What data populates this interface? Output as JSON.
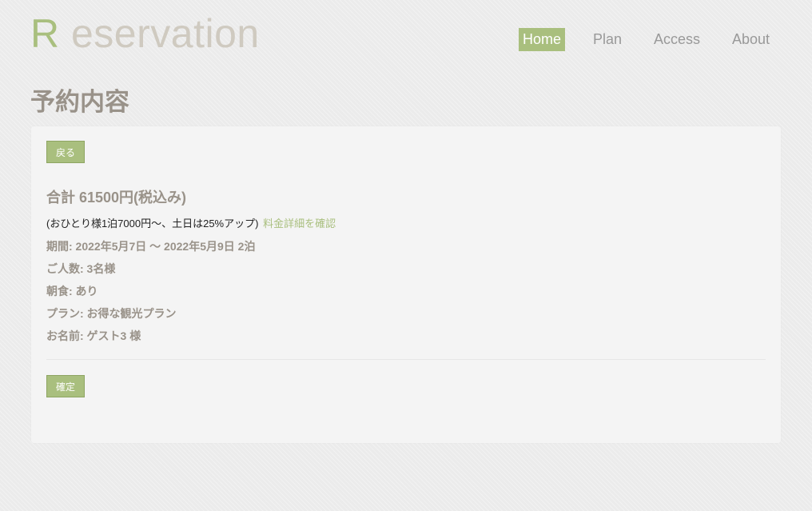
{
  "logo": {
    "initial": "R",
    "rest": " eservation"
  },
  "nav": {
    "items": [
      {
        "label": "Home",
        "active": true
      },
      {
        "label": "Plan",
        "active": false
      },
      {
        "label": "Access",
        "active": false
      },
      {
        "label": "About",
        "active": false
      }
    ]
  },
  "page_title": "予約内容",
  "back_button": "戻る",
  "total": "合計 61500円(税込み)",
  "total_note": {
    "text": "(おひとり様1泊7000円～、土日は25%アップ)",
    "link": "料金詳細を確認"
  },
  "details": {
    "period": "期間: 2022年5月7日 〜 2022年5月9日 2泊",
    "people": "ご人数: 3名様",
    "breakfast": "朝食: あり",
    "plan": "プラン: お得な観光プラン",
    "name": "お名前: ゲスト3 様"
  },
  "confirm_button": "確定",
  "colors": {
    "accent": "#a9bf7e",
    "text_muted": "#999289",
    "logo_text": "#cfcac0",
    "panel": "#f4f4f4"
  }
}
